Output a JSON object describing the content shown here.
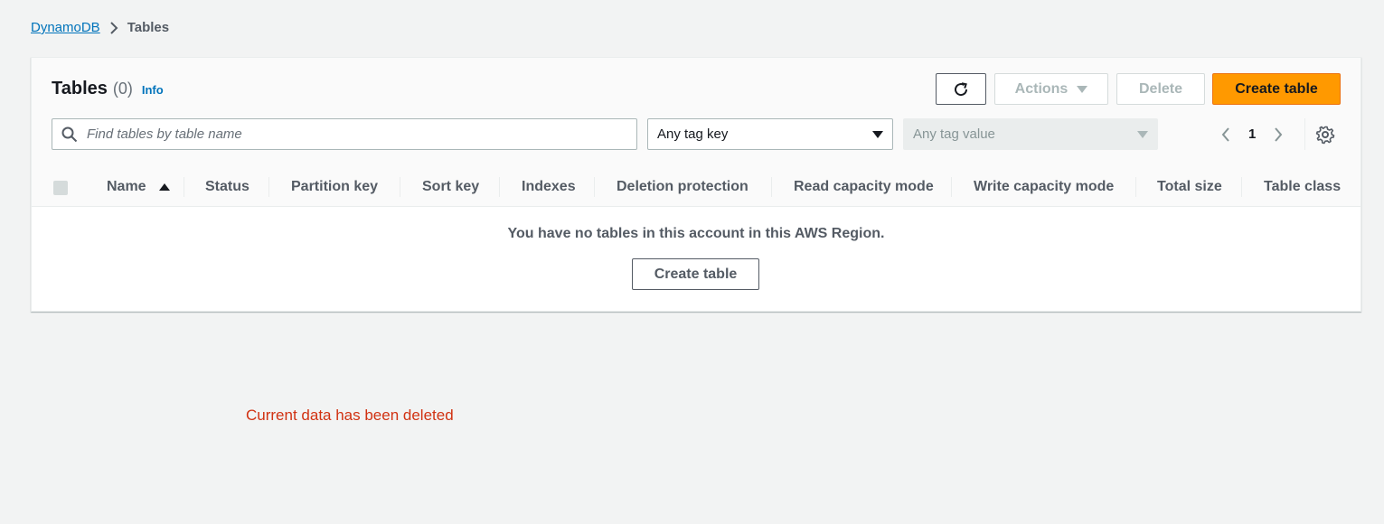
{
  "breadcrumb": {
    "root": "DynamoDB",
    "current": "Tables"
  },
  "panel": {
    "title": "Tables",
    "count": "(0)",
    "info": "Info",
    "buttons": {
      "actions": "Actions",
      "delete": "Delete",
      "create": "Create table"
    },
    "search": {
      "placeholder": "Find tables by table name",
      "value": ""
    },
    "tag_key": {
      "selected": "Any tag key"
    },
    "tag_value": {
      "selected": "Any tag value",
      "disabled": true
    },
    "pagination": {
      "page": "1"
    }
  },
  "table": {
    "columns": [
      "Name",
      "Status",
      "Partition key",
      "Sort key",
      "Indexes",
      "Deletion protection",
      "Read capacity mode",
      "Write capacity mode",
      "Total size",
      "Table class"
    ],
    "sort": {
      "column": "Name",
      "direction": "ascending"
    },
    "empty_message": "You have no tables in this account in this AWS Region.",
    "empty_button": "Create table"
  },
  "status_message": "Current data has been deleted",
  "colors": {
    "primary": "#ff9900",
    "link": "#0073bb",
    "error": "#d13212",
    "background": "#f2f3f3"
  },
  "icons": [
    "chevron-right-icon",
    "refresh-icon",
    "caret-down-icon",
    "search-icon",
    "chevron-left-icon",
    "gear-icon",
    "sort-ascending-icon"
  ]
}
